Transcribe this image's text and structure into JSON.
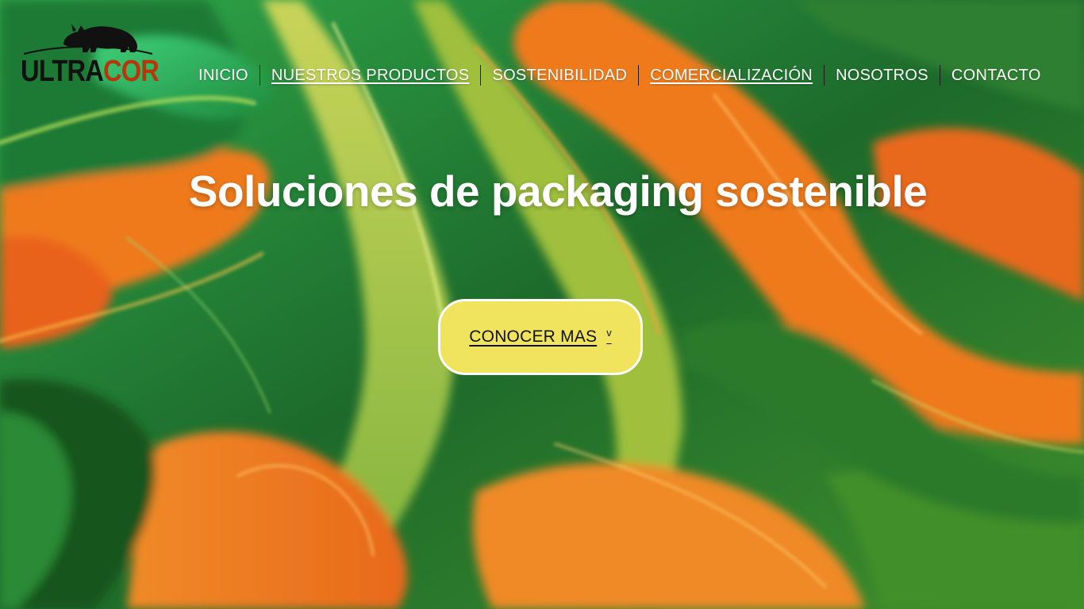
{
  "brand": {
    "logo_word_part1": "ULTRA",
    "logo_word_part2": "COR",
    "logo_icon": "rhino-icon"
  },
  "nav": {
    "items": [
      {
        "label": "INICIO",
        "underlined": false
      },
      {
        "label": "NUESTROS PRODUCTOS",
        "underlined": true
      },
      {
        "label": "SOSTENIBILIDAD",
        "underlined": false
      },
      {
        "label": "COMERCIALIZACIÓN",
        "underlined": true
      },
      {
        "label": "NOSOTROS",
        "underlined": false
      },
      {
        "label": "CONTACTO",
        "underlined": false
      }
    ]
  },
  "hero": {
    "title": "Soluciones de packaging sostenible",
    "cta_label": "CONOCER MAS",
    "cta_chevron": "v",
    "cta_icon": "chevron-down-icon"
  },
  "colors": {
    "cta_background": "#f0e35e",
    "brand_red": "#b5380d",
    "background_green": "#1f6b2a",
    "background_orange": "#ef7a1e"
  }
}
